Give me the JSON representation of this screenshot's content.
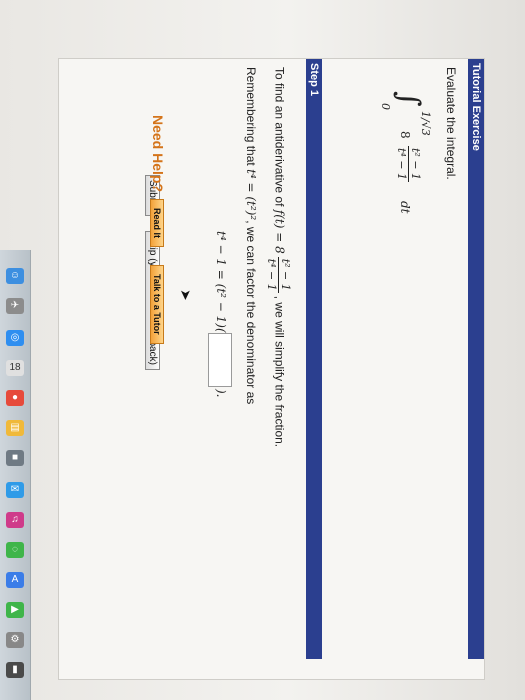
{
  "header": {
    "title": "Tutorial Exercise"
  },
  "prompt": "Evaluate the integral.",
  "integral": {
    "symbol": "∫",
    "upper": "1/√3",
    "lower": "0",
    "coeff": "8",
    "numerator": "t² − 1",
    "denominator": "t⁴ − 1",
    "differential": "dt"
  },
  "step": {
    "label": "Step 1",
    "line1_before": "To find an antiderivative of",
    "line1_func": "f(t) = 8",
    "line1_num": "t² − 1",
    "line1_den": "t⁴ − 1",
    "line1_after": ", we will simplify the fraction.",
    "line2_before": "Remembering that",
    "line2_math": "t⁴ = (t²)²",
    "line2_after": ", we can factor the denominator as",
    "line3_math": "t⁴ − 1 = (t² − 1)(",
    "line3_close": ")."
  },
  "buttons": {
    "submit": "Submit",
    "skip": "Skip (you cannot come back)",
    "read_it": "Read It",
    "talk_to_tutor": "Talk to a Tutor"
  },
  "help": {
    "label": "Need Help?"
  },
  "colors": {
    "header_bar": "#2b3f8f",
    "help_text": "#d4741a",
    "help_buttons": "#f3a23a"
  },
  "dock": {
    "icons": [
      "finder-icon",
      "launchpad-icon",
      "safari-icon",
      "chrome-icon",
      "mail-icon",
      "calendar-icon",
      "photos-icon",
      "messages-icon",
      "facetime-icon",
      "music-icon",
      "app-store-icon",
      "settings-icon"
    ],
    "calendar_day": "18"
  }
}
